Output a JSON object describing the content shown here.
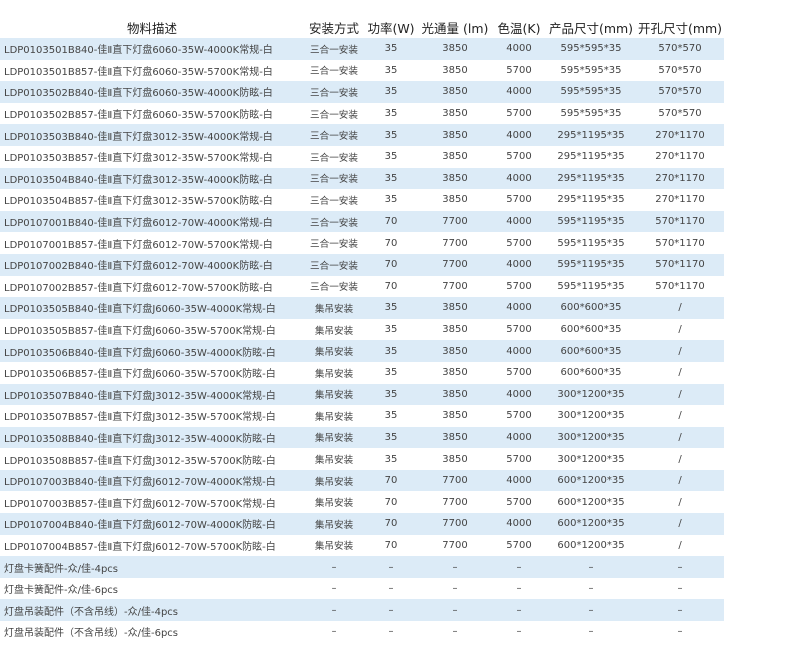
{
  "table": {
    "headers": [
      "物料描述",
      "安装方式",
      "功率(W)",
      "光通量 (lm)",
      "色温(K)",
      "产品尺寸(mm)",
      "开孔尺寸(mm)"
    ],
    "rows": [
      [
        "LDP0103501B840-佳Ⅱ直下灯盘6060-35W-4000K常规-白",
        "三合一安装",
        "35",
        "3850",
        "4000",
        "595*595*35",
        "570*570"
      ],
      [
        "LDP0103501B857-佳Ⅱ直下灯盘6060-35W-5700K常规-白",
        "三合一安装",
        "35",
        "3850",
        "5700",
        "595*595*35",
        "570*570"
      ],
      [
        "LDP0103502B840-佳Ⅱ直下灯盘6060-35W-4000K防眩-白",
        "三合一安装",
        "35",
        "3850",
        "4000",
        "595*595*35",
        "570*570"
      ],
      [
        "LDP0103502B857-佳Ⅱ直下灯盘6060-35W-5700K防眩-白",
        "三合一安装",
        "35",
        "3850",
        "5700",
        "595*595*35",
        "570*570"
      ],
      [
        "LDP0103503B840-佳Ⅱ直下灯盘3012-35W-4000K常规-白",
        "三合一安装",
        "35",
        "3850",
        "4000",
        "295*1195*35",
        "270*1170"
      ],
      [
        "LDP0103503B857-佳Ⅱ直下灯盘3012-35W-5700K常规-白",
        "三合一安装",
        "35",
        "3850",
        "5700",
        "295*1195*35",
        "270*1170"
      ],
      [
        "LDP0103504B840-佳Ⅱ直下灯盘3012-35W-4000K防眩-白",
        "三合一安装",
        "35",
        "3850",
        "4000",
        "295*1195*35",
        "270*1170"
      ],
      [
        "LDP0103504B857-佳Ⅱ直下灯盘3012-35W-5700K防眩-白",
        "三合一安装",
        "35",
        "3850",
        "5700",
        "295*1195*35",
        "270*1170"
      ],
      [
        "LDP0107001B840-佳Ⅱ直下灯盘6012-70W-4000K常规-白",
        "三合一安装",
        "70",
        "7700",
        "4000",
        "595*1195*35",
        "570*1170"
      ],
      [
        "LDP0107001B857-佳Ⅱ直下灯盘6012-70W-5700K常规-白",
        "三合一安装",
        "70",
        "7700",
        "5700",
        "595*1195*35",
        "570*1170"
      ],
      [
        "LDP0107002B840-佳Ⅱ直下灯盘6012-70W-4000K防眩-白",
        "三合一安装",
        "70",
        "7700",
        "4000",
        "595*1195*35",
        "570*1170"
      ],
      [
        "LDP0107002B857-佳Ⅱ直下灯盘6012-70W-5700K防眩-白",
        "三合一安装",
        "70",
        "7700",
        "5700",
        "595*1195*35",
        "570*1170"
      ],
      [
        "LDP0103505B840-佳Ⅱ直下灯盘J6060-35W-4000K常规-白",
        "集吊安装",
        "35",
        "3850",
        "4000",
        "600*600*35",
        "/"
      ],
      [
        "LDP0103505B857-佳Ⅱ直下灯盘J6060-35W-5700K常规-白",
        "集吊安装",
        "35",
        "3850",
        "5700",
        "600*600*35",
        "/"
      ],
      [
        "LDP0103506B840-佳Ⅱ直下灯盘J6060-35W-4000K防眩-白",
        "集吊安装",
        "35",
        "3850",
        "4000",
        "600*600*35",
        "/"
      ],
      [
        "LDP0103506B857-佳Ⅱ直下灯盘J6060-35W-5700K防眩-白",
        "集吊安装",
        "35",
        "3850",
        "5700",
        "600*600*35",
        "/"
      ],
      [
        "LDP0103507B840-佳Ⅱ直下灯盘J3012-35W-4000K常规-白",
        "集吊安装",
        "35",
        "3850",
        "4000",
        "300*1200*35",
        "/"
      ],
      [
        "LDP0103507B857-佳Ⅱ直下灯盘J3012-35W-5700K常规-白",
        "集吊安装",
        "35",
        "3850",
        "5700",
        "300*1200*35",
        "/"
      ],
      [
        "LDP0103508B840-佳Ⅱ直下灯盘J3012-35W-4000K防眩-白",
        "集吊安装",
        "35",
        "3850",
        "4000",
        "300*1200*35",
        "/"
      ],
      [
        "LDP0103508B857-佳Ⅱ直下灯盘J3012-35W-5700K防眩-白",
        "集吊安装",
        "35",
        "3850",
        "5700",
        "300*1200*35",
        "/"
      ],
      [
        "LDP0107003B840-佳Ⅱ直下灯盘J6012-70W-4000K常规-白",
        "集吊安装",
        "70",
        "7700",
        "4000",
        "600*1200*35",
        "/"
      ],
      [
        "LDP0107003B857-佳Ⅱ直下灯盘J6012-70W-5700K常规-白",
        "集吊安装",
        "70",
        "7700",
        "5700",
        "600*1200*35",
        "/"
      ],
      [
        "LDP0107004B840-佳Ⅱ直下灯盘J6012-70W-4000K防眩-白",
        "集吊安装",
        "70",
        "7700",
        "4000",
        "600*1200*35",
        "/"
      ],
      [
        "LDP0107004B857-佳Ⅱ直下灯盘J6012-70W-5700K防眩-白",
        "集吊安装",
        "70",
        "7700",
        "5700",
        "600*1200*35",
        "/"
      ],
      [
        "灯盘卡簧配件-众/佳-4pcs",
        "–",
        "–",
        "–",
        "–",
        "–",
        "–"
      ],
      [
        "灯盘卡簧配件-众/佳-6pcs",
        "–",
        "–",
        "–",
        "–",
        "–",
        "–"
      ],
      [
        "灯盘吊装配件（不含吊线）-众/佳-4pcs",
        "–",
        "–",
        "–",
        "–",
        "–",
        "–"
      ],
      [
        "灯盘吊装配件（不含吊线）-众/佳-6pcs",
        "–",
        "–",
        "–",
        "–",
        "–",
        "–"
      ]
    ]
  },
  "colors": {
    "stripe": "#dcebf7",
    "text": "#444444"
  }
}
